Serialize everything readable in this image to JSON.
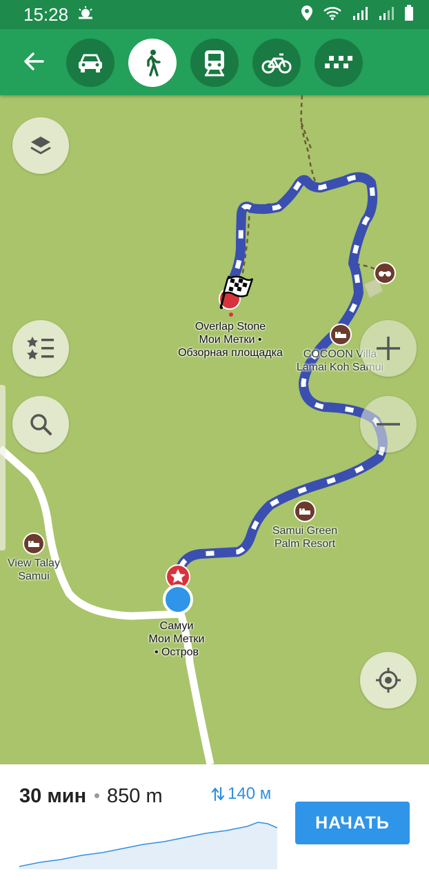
{
  "status_bar": {
    "time": "15:28",
    "icons": [
      "weather-icon",
      "location-icon",
      "wifi-icon",
      "signal-r-icon",
      "signal-r-icon",
      "battery-icon"
    ]
  },
  "mode_bar": {
    "back_icon": "arrow-left-icon",
    "modes": [
      {
        "name": "car",
        "icon": "car-icon",
        "active": false
      },
      {
        "name": "walk",
        "icon": "pedestrian-icon",
        "active": true
      },
      {
        "name": "transit",
        "icon": "train-icon",
        "active": false
      },
      {
        "name": "bike",
        "icon": "bicycle-icon",
        "active": false
      },
      {
        "name": "taxi",
        "icon": "taxi-icon",
        "active": false
      }
    ]
  },
  "map": {
    "controls": [
      "layers-icon",
      "bookmarks-icon",
      "search-icon",
      "zoom-in-icon",
      "zoom-out-icon",
      "my-location-icon"
    ],
    "destination": {
      "name": "Overlap Stone",
      "line2": "Мои Метки •",
      "line3": "Обзорная площадка"
    },
    "origin": {
      "name": "Самуи",
      "line2": "Мои Метки",
      "line3": "• Остров"
    },
    "pois": [
      {
        "id": "cocoon",
        "line1": "COCOON Villa",
        "line2": "Lamai Koh Samui"
      },
      {
        "id": "samui-green",
        "line1": "Samui Green",
        "line2": "Palm Resort"
      },
      {
        "id": "view-talay",
        "line1": "View Talay",
        "line2": "Samui"
      }
    ]
  },
  "route_summary": {
    "time": "30 мин",
    "distance": "850 m",
    "elevation": "140 м",
    "start_button": "НАЧАТЬ"
  },
  "colors": {
    "header_green": "#23a05a",
    "status_green": "#1e8a4c",
    "map_green": "#a9c46a",
    "route_blue": "#3a4fb0",
    "accent_blue": "#2f95e8"
  }
}
